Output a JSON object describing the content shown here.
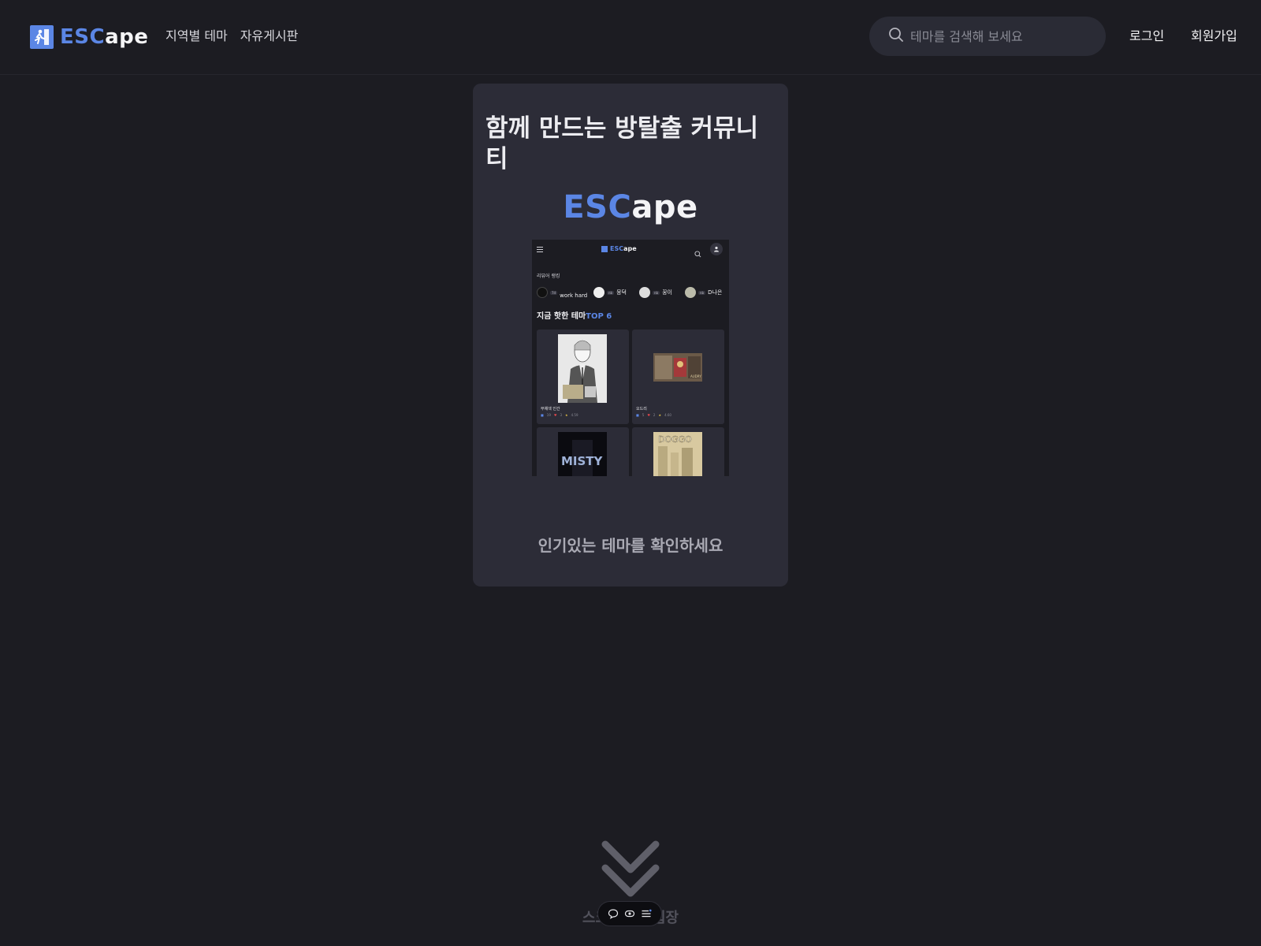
{
  "header": {
    "logo": {
      "part1": "ESC",
      "part2": "ape"
    },
    "nav": [
      "지역별 테마",
      "자유게시판"
    ],
    "search": {
      "placeholder": "테마를 검색해 보세요",
      "value": ""
    },
    "login_label": "로그인",
    "signup_label": "회원가입"
  },
  "card": {
    "title": "함께 만드는 방탈출 커뮤니티",
    "logo": {
      "part1": "ESC",
      "part2": "ape"
    },
    "caption": "인기있는 테마를 확인하세요",
    "preview": {
      "logo": {
        "part1": "ESC",
        "part2": "ape"
      },
      "ranking_title": "리뷰어 랭킹",
      "rankers": [
        {
          "badge": "7d",
          "name": "work hard"
        },
        {
          "badge": "nb",
          "name": "뭉덕"
        },
        {
          "badge": "nb",
          "name": "꿍이"
        },
        {
          "badge": "nb",
          "name": "D나은"
        }
      ],
      "hot_title": "지금 핫한 테마",
      "hot_accent": "TOP 6",
      "themes": [
        {
          "name": "무채색 인간",
          "reviews": "19",
          "likes": "3",
          "rating": "4.59"
        },
        {
          "name": "오드리",
          "reviews": "5",
          "likes": "2",
          "rating": "4.60"
        },
        {
          "name": "",
          "reviews": "",
          "likes": "",
          "rating": ""
        },
        {
          "name": "",
          "reviews": "",
          "likes": "",
          "rating": ""
        }
      ],
      "thumb_texts": [
        "MISTY",
        "DOGGO"
      ]
    }
  },
  "scroll_cue": {
    "text": "스크롤하여 입장"
  },
  "colors": {
    "accent": "#5b86e5",
    "background": "#1c1c22",
    "card": "#2c2c37"
  },
  "icons": [
    "runner-logo-icon",
    "search-icon",
    "chevron-down-icon",
    "chat-icon",
    "eye-icon",
    "menu-icon"
  ]
}
